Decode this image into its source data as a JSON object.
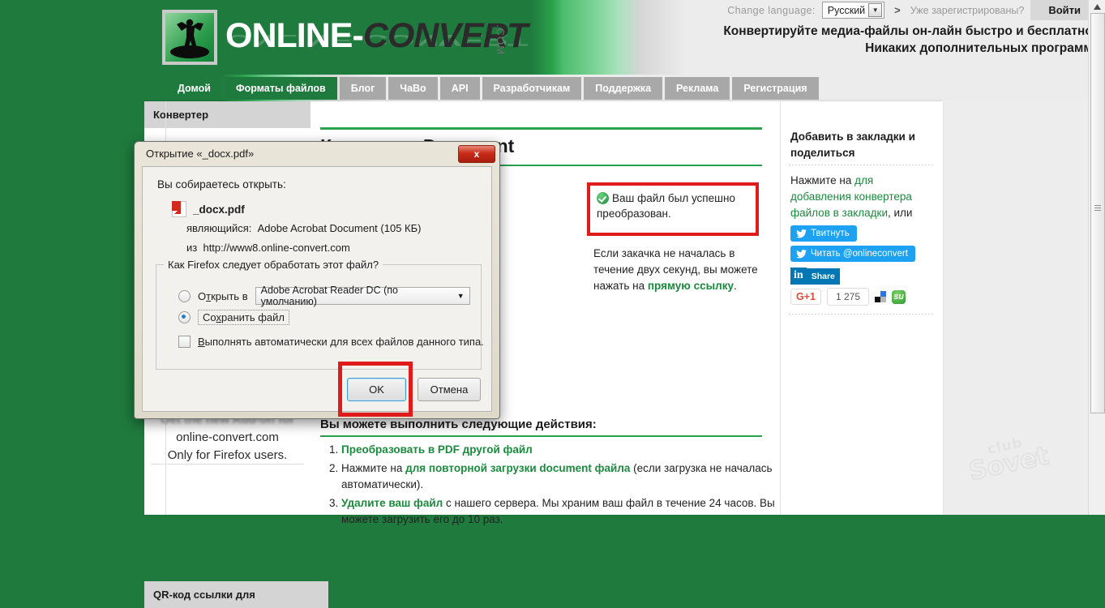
{
  "header": {
    "logo_part1": "ONLINE",
    "logo_dash": "-",
    "logo_part2": "CONVERT",
    "logo_com": ".COM",
    "change_language_label": "Change language:",
    "language_value": "Русский",
    "go_symbol": ">",
    "already_registered": "Уже зарегистрированы?",
    "login_button": "Войти",
    "tagline_line1": "Конвертируйте медиа-файлы он-лайн быстро и бесплатно!",
    "tagline_line2": "Никаких дополнительных программ!"
  },
  "nav": {
    "items": [
      {
        "label": "Домой",
        "active": true
      },
      {
        "label": "Форматы файлов",
        "active": true
      },
      {
        "label": "Блог",
        "active": false
      },
      {
        "label": "ЧаВо",
        "active": false
      },
      {
        "label": "API",
        "active": false
      },
      {
        "label": "Разработчикам",
        "active": false
      },
      {
        "label": "Поддержка",
        "active": false
      },
      {
        "label": "Реклама",
        "active": false
      },
      {
        "label": "Регистрация",
        "active": false
      }
    ]
  },
  "left_sidebar": {
    "header": "Конвертер",
    "addon_blurred": "Get the new Add-on for",
    "addon_line1": "online-convert.com",
    "addon_line2": "Only for Firefox users.",
    "qr_header": "QR-код ссылки для"
  },
  "main": {
    "page_title": "Конвертер Document",
    "actions_title": "Вы можете выполнить следующие действия:",
    "actions": [
      {
        "num": "1.",
        "bold": "Преобразовать в PDF другой файл",
        "rest": ""
      },
      {
        "num": "2.",
        "pre": "Нажмите на ",
        "bold": "для повторной загрузки document файла",
        "rest": " (если загрузка не началась автоматически)."
      },
      {
        "num": "3.",
        "bold": "Удалите ваш файл",
        "rest": " с нашего сервера. Мы храним ваш файл в течение 24 часов. Вы можете загрузить его до 10 раз."
      }
    ]
  },
  "success": {
    "message": "Ваш файл был успешно преобразован.",
    "note_pre": "Если закачка не началась в течение двух секунд, вы можете нажать на ",
    "note_link": "прямую ссылку",
    "note_post": ".",
    "border_color": "#e01b1b"
  },
  "right_sidebar": {
    "header": "Добавить в закладки и поделиться",
    "text_pre": "Нажмите на ",
    "text_link": "для добавления конвертера файлов в закладки",
    "text_post": ", или",
    "tweet_button": "Твитнуть",
    "follow_button": "Читать @onlineconvert",
    "linkedin_mark": "in",
    "linkedin_share": "Share",
    "gplus_label": "G+1",
    "gplus_count": "1 275",
    "twitter_color": "#1da1f2",
    "linkedin_color": "#0077b5"
  },
  "dialog": {
    "title": "Открытие «_docx.pdf»",
    "close_label": "x",
    "lead": "Вы собираетесь открыть:",
    "file_name": "_docx.pdf",
    "type_label": "являющийся:",
    "type_value": "Adobe Acrobat Document (105 КБ)",
    "from_label": "из",
    "from_value": "http://www8.online-convert.com",
    "group_legend": "Как Firefox следует обработать этот файл?",
    "open_with_label": "Открыть в",
    "open_with_value": "Adobe Acrobat Reader DC  (по умолчанию)",
    "save_file_label": "Сохранить файл",
    "auto_label": "Выполнять автоматически для всех файлов данного типа.",
    "ok_button": "OK",
    "cancel_button": "Отмена",
    "selected_option": "save",
    "auto_checked": false
  },
  "watermark": {
    "line1": "club",
    "line2": "Sovet"
  }
}
